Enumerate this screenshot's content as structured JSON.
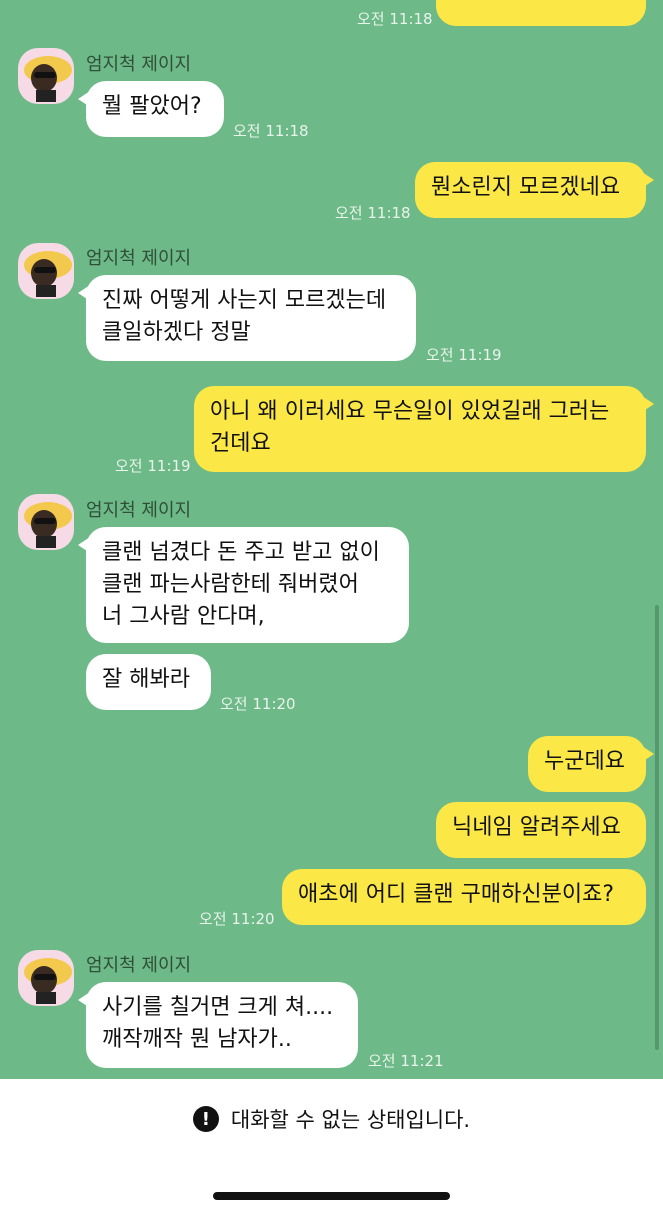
{
  "partial_top": {
    "out_text": "?",
    "time": "오전 11:18"
  },
  "messages": {
    "m1": {
      "sender": "엄지척 제이지",
      "text": "뭘 팔았어?",
      "time": "오전 11:18"
    },
    "m2": {
      "text": "뭔소린지 모르겠네요",
      "time": "오전 11:18"
    },
    "m3": {
      "sender": "엄지척 제이지",
      "line1": "진짜 어떻게 사는지 모르겠는데",
      "line2": "클일하겠다 정말",
      "time": "오전 11:19"
    },
    "m4": {
      "line1": "아니 왜 이러세요 무슨일이 있었길래 그러는",
      "line2": "건데요",
      "time": "오전 11:19"
    },
    "m5": {
      "sender": "엄지척 제이지",
      "line1": "클랜 넘겼다 돈 주고 받고 없이",
      "line2": "클랜 파는사람한테 줘버렸어",
      "line3": "너 그사람 안다며,"
    },
    "m6": {
      "text": "잘 해봐라",
      "time": "오전 11:20"
    },
    "m7": {
      "text": "누군데요"
    },
    "m8": {
      "text": "닉네임 알려주세요"
    },
    "m9": {
      "text": "애초에 어디 클랜 구매하신분이죠?",
      "time": "오전 11:20"
    },
    "m10": {
      "sender": "엄지척 제이지",
      "line1": "사기를 칠거면 크게 쳐....",
      "line2": "깨작깨작 뭔 남자가..",
      "time": "오전 11:21"
    }
  },
  "footer": {
    "notice_icon": "exclamation-circle-icon",
    "notice_text": "대화할 수 없는 상태입니다."
  }
}
